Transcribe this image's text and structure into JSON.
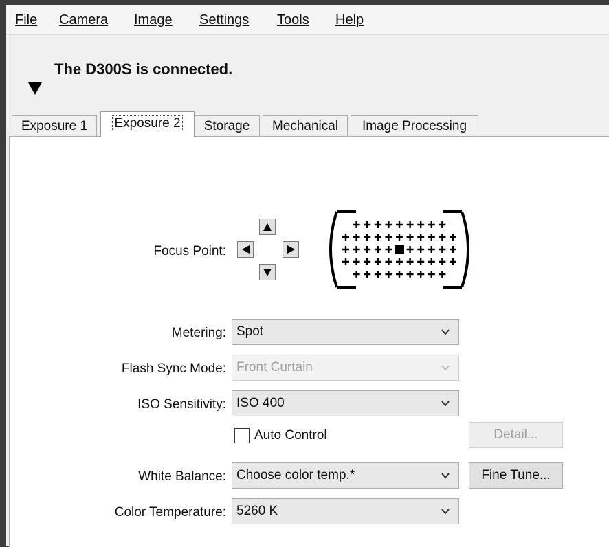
{
  "menu": [
    "File",
    "Camera",
    "Image",
    "Settings",
    "Tools",
    "Help"
  ],
  "status_text": "The D300S is connected.",
  "tabs": [
    "Exposure 1",
    "Exposure 2",
    "Storage",
    "Mechanical",
    "Image Processing"
  ],
  "active_tab": "Exposure 2",
  "focus_point": {
    "label": "Focus Point:",
    "grid_rows": [
      9,
      11,
      11,
      11,
      9
    ],
    "selected_row": 2,
    "selected_col": 5
  },
  "metering": {
    "label": "Metering:",
    "value": "Spot"
  },
  "flash_sync": {
    "label": "Flash Sync Mode:",
    "value": "Front Curtain",
    "disabled": true
  },
  "iso": {
    "label": "ISO Sensitivity:",
    "value": "ISO 400"
  },
  "auto_control": {
    "label": "Auto Control",
    "checked": false
  },
  "detail_button": {
    "label": "Detail...",
    "disabled": true
  },
  "white_balance": {
    "label": "White Balance:",
    "value": "Choose color temp.*"
  },
  "fine_tune_button": {
    "label": "Fine Tune..."
  },
  "color_temperature": {
    "label": "Color Temperature:",
    "value": "5260 K"
  }
}
